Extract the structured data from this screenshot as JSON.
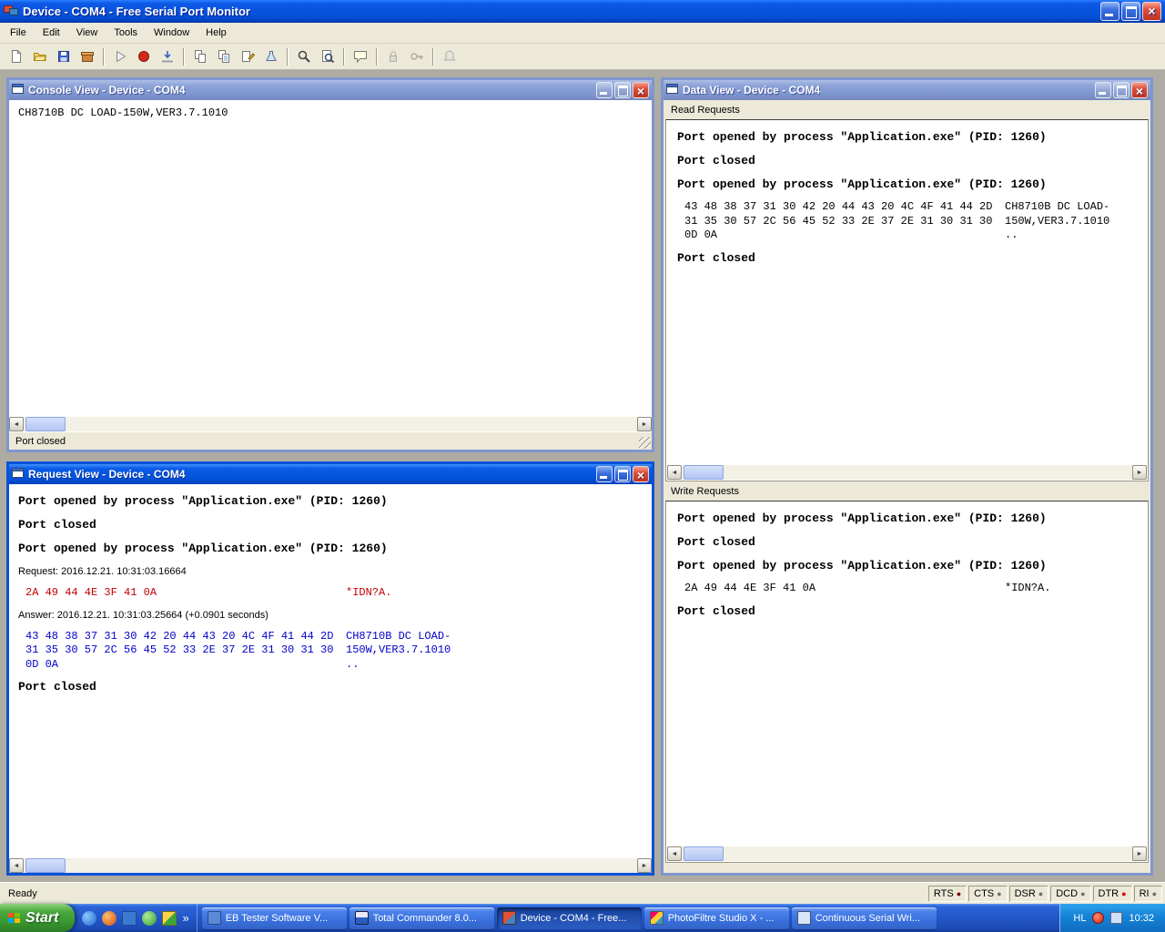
{
  "window": {
    "title": "Device - COM4 - Free Serial Port Monitor"
  },
  "menu": {
    "items": [
      "File",
      "Edit",
      "View",
      "Tools",
      "Window",
      "Help"
    ]
  },
  "toolbar": {
    "icons": [
      "new-icon",
      "open-icon",
      "save-icon",
      "export-icon",
      "start-icon",
      "stop-icon",
      "restart-icon",
      "copy-icon",
      "copy-text-icon",
      "edit-icon",
      "filter-icon",
      "find-icon",
      "zoom-document-icon",
      "comment-icon",
      "lock-icon",
      "key-icon",
      "alert-icon"
    ]
  },
  "console_view": {
    "title": "Console View - Device - COM4",
    "content": "CH8710B DC LOAD-150W,VER3.7.1010",
    "status": "Port closed"
  },
  "request_view": {
    "title": "Request View - Device - COM4",
    "line1": "Port opened by process \"Application.exe\" (PID: 1260)",
    "line2": "Port closed",
    "line3": "Port opened by process \"Application.exe\" (PID: 1260)",
    "request_label": "Request: 2016.12.21. 10:31:03.16664",
    "request_hex": "2A 49 44 4E 3F 41 0A",
    "request_ascii": "*IDN?A.",
    "answer_label": "Answer: 2016.12.21. 10:31:03.25664 (+0.0901 seconds)",
    "answer_hex": [
      "43 48 38 37 31 30 42 20 44 43 20 4C 4F 41 44 2D",
      "31 35 30 57 2C 56 45 52 33 2E 37 2E 31 30 31 30",
      "0D 0A"
    ],
    "answer_ascii": [
      "CH8710B DC LOAD-",
      "150W,VER3.7.1010",
      ".."
    ],
    "line4": "Port closed"
  },
  "data_view": {
    "title": "Data View - Device - COM4",
    "read": {
      "label": "Read Requests",
      "line1": "Port opened by process \"Application.exe\" (PID: 1260)",
      "line2": "Port closed",
      "line3": "Port opened by process \"Application.exe\" (PID: 1260)",
      "hex": [
        "43 48 38 37 31 30 42 20 44 43 20 4C 4F 41 44 2D",
        "31 35 30 57 2C 56 45 52 33 2E 37 2E 31 30 31 30",
        "0D 0A"
      ],
      "ascii": [
        "CH8710B DC LOAD-",
        "150W,VER3.7.1010",
        ".."
      ],
      "line4": "Port closed"
    },
    "write": {
      "label": "Write Requests",
      "line1": "Port opened by process \"Application.exe\" (PID: 1260)",
      "line2": "Port closed",
      "line3": "Port opened by process \"Application.exe\" (PID: 1260)",
      "hex": "2A 49 44 4E 3F 41 0A",
      "ascii": "*IDN?A.",
      "line4": "Port closed"
    }
  },
  "status_bar": {
    "ready": "Ready",
    "signals": [
      {
        "label": "RTS",
        "color": "#7b0000"
      },
      {
        "label": "CTS",
        "color": "#6e6e6e"
      },
      {
        "label": "DSR",
        "color": "#6e6e6e"
      },
      {
        "label": "DCD",
        "color": "#6e6e6e"
      },
      {
        "label": "DTR",
        "color": "#e00000"
      },
      {
        "label": "RI",
        "color": "#6e6e6e"
      }
    ]
  },
  "taskbar": {
    "start_label": "Start",
    "tasks": [
      {
        "label": "EB Tester Software V..."
      },
      {
        "label": "Total Commander 8.0..."
      },
      {
        "label": "Device - COM4 - Free..."
      },
      {
        "label": "PhotoFiltre Studio X - ..."
      },
      {
        "label": "Continuous Serial Wri..."
      }
    ],
    "tray_label": "HL",
    "clock": "10:32"
  }
}
